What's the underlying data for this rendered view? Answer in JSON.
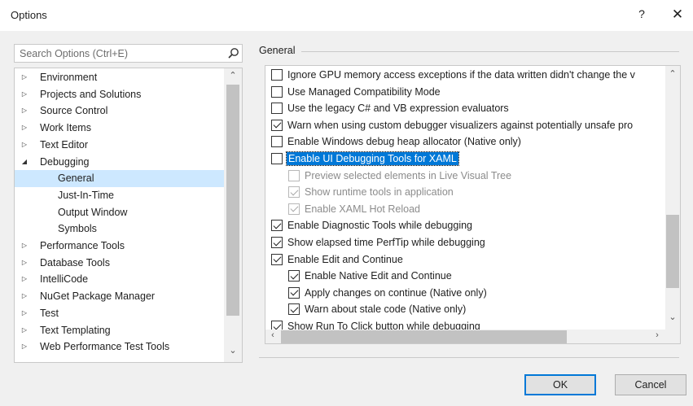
{
  "window": {
    "title": "Options",
    "help_label": "?",
    "close_label": "✕"
  },
  "search": {
    "placeholder": "Search Options (Ctrl+E)",
    "value": ""
  },
  "tree": {
    "items": [
      {
        "label": "Environment",
        "arrow": "▷",
        "level": 0
      },
      {
        "label": "Projects and Solutions",
        "arrow": "▷",
        "level": 0
      },
      {
        "label": "Source Control",
        "arrow": "▷",
        "level": 0
      },
      {
        "label": "Work Items",
        "arrow": "▷",
        "level": 0
      },
      {
        "label": "Text Editor",
        "arrow": "▷",
        "level": 0
      },
      {
        "label": "Debugging",
        "arrow": "◢",
        "level": 0
      },
      {
        "label": "General",
        "arrow": "",
        "level": 1,
        "selected": true
      },
      {
        "label": "Just-In-Time",
        "arrow": "",
        "level": 1
      },
      {
        "label": "Output Window",
        "arrow": "",
        "level": 1
      },
      {
        "label": "Symbols",
        "arrow": "",
        "level": 1
      },
      {
        "label": "Performance Tools",
        "arrow": "▷",
        "level": 0
      },
      {
        "label": "Database Tools",
        "arrow": "▷",
        "level": 0
      },
      {
        "label": "IntelliCode",
        "arrow": "▷",
        "level": 0
      },
      {
        "label": "NuGet Package Manager",
        "arrow": "▷",
        "level": 0
      },
      {
        "label": "Test",
        "arrow": "▷",
        "level": 0
      },
      {
        "label": "Text Templating",
        "arrow": "▷",
        "level": 0
      },
      {
        "label": "Web Performance Test Tools",
        "arrow": "▷",
        "level": 0
      }
    ]
  },
  "general": {
    "group_title": "General",
    "options": [
      {
        "label": "Ignore GPU memory access exceptions if the data written didn't change the v",
        "checked": false,
        "indent": 0
      },
      {
        "label": "Use Managed Compatibility Mode",
        "checked": false,
        "indent": 0
      },
      {
        "label": "Use the legacy C# and VB expression evaluators",
        "checked": false,
        "indent": 0
      },
      {
        "label": "Warn when using custom debugger visualizers against potentially unsafe pro",
        "checked": true,
        "indent": 0
      },
      {
        "label": "Enable Windows debug heap allocator (Native only)",
        "checked": false,
        "indent": 0
      },
      {
        "label": "Enable UI Debugging Tools for XAML",
        "checked": false,
        "indent": 0,
        "highlight": true
      },
      {
        "label": "Preview selected elements in Live Visual Tree",
        "checked": false,
        "indent": 1,
        "disabled": true
      },
      {
        "label": "Show runtime tools in application",
        "checked": true,
        "indent": 1,
        "disabled": true
      },
      {
        "label": "Enable XAML Hot Reload",
        "checked": true,
        "indent": 1,
        "disabled": true
      },
      {
        "label": "Enable Diagnostic Tools while debugging",
        "checked": true,
        "indent": 0
      },
      {
        "label": "Show elapsed time PerfTip while debugging",
        "checked": true,
        "indent": 0
      },
      {
        "label": "Enable Edit and Continue",
        "checked": true,
        "indent": 0
      },
      {
        "label": "Enable Native Edit and Continue",
        "checked": true,
        "indent": 1
      },
      {
        "label": "Apply changes on continue (Native only)",
        "checked": true,
        "indent": 1
      },
      {
        "label": "Warn about stale code (Native only)",
        "checked": true,
        "indent": 1
      },
      {
        "label": "Show Run To Click button while debugging",
        "checked": true,
        "indent": 0
      }
    ]
  },
  "buttons": {
    "ok": "OK",
    "cancel": "Cancel"
  },
  "colors": {
    "selection": "#cde8ff",
    "highlight": "#0078d7",
    "accent": "#0078d7"
  }
}
